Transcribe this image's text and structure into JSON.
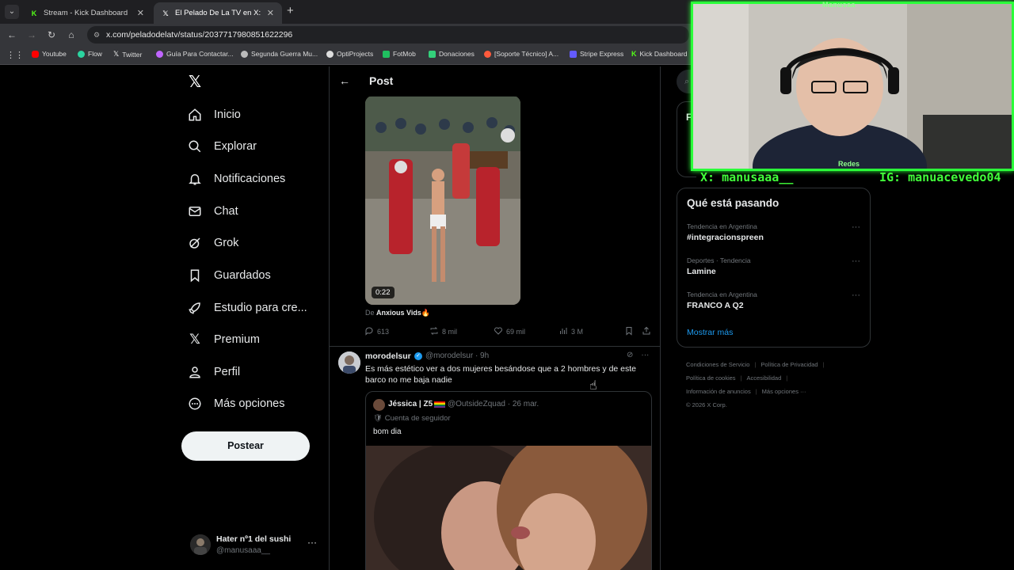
{
  "browser": {
    "tabs": [
      {
        "title": "Stream - Kick Dashboard",
        "icon": "kick-icon",
        "icon_color": "#53fc18"
      },
      {
        "title": "El Pelado De La TV en X: \"Will F",
        "icon": "x-icon",
        "icon_color": "#ffffff"
      }
    ],
    "url": "x.com/peladodelatv/status/2037717980851622296",
    "bookmarks": [
      {
        "label": "Youtube",
        "color": "#ff0000"
      },
      {
        "label": "Flow",
        "color": "#2bd4a0"
      },
      {
        "label": "Twitter",
        "color": "#ffffff"
      },
      {
        "label": "Guía Para Contactar...",
        "color": "#c065ff"
      },
      {
        "label": "Segunda Guerra Mu...",
        "color": "#bbbbbb"
      },
      {
        "label": "OptiProjects",
        "color": "#dddddd"
      },
      {
        "label": "FotMob",
        "color": "#20c060"
      },
      {
        "label": "Donaciones",
        "color": "#33d07a"
      },
      {
        "label": "[Soporte Técnico] A...",
        "color": "#ff5a3c"
      },
      {
        "label": "Stripe Express",
        "color": "#635bff"
      },
      {
        "label": "Kick Dashboard",
        "color": "#53fc18"
      }
    ]
  },
  "nav": {
    "items": [
      {
        "label": "Inicio",
        "icon": "home-icon"
      },
      {
        "label": "Explorar",
        "icon": "search-icon"
      },
      {
        "label": "Notificaciones",
        "icon": "bell-icon"
      },
      {
        "label": "Chat",
        "icon": "mail-icon"
      },
      {
        "label": "Grok",
        "icon": "grok-icon"
      },
      {
        "label": "Guardados",
        "icon": "bookmark-icon"
      },
      {
        "label": "Estudio para cre...",
        "icon": "rocket-icon"
      },
      {
        "label": "Premium",
        "icon": "x-icon"
      },
      {
        "label": "Perfil",
        "icon": "person-icon"
      },
      {
        "label": "Más opciones",
        "icon": "more-circle-icon"
      }
    ],
    "post_button": "Postear",
    "account": {
      "name": "Hater nº1 del sushi",
      "handle": "@manusaaa__"
    }
  },
  "post": {
    "header": "Post",
    "video_duration": "0:22",
    "from_prefix": "De ",
    "from_name": "Anxious Vids🔥",
    "stats": {
      "replies": "613",
      "reposts": "8 mil",
      "likes": "69 mil",
      "views": "3 M"
    }
  },
  "reply": {
    "name": "morodelsur",
    "handle_time": "@morodelsur · 9h",
    "text": "Es más estético ver a dos mujeres besándose que a 2 hombres y de este barco no me baja nadie",
    "quote": {
      "name": "Jéssica | Z5",
      "handle_time": "@OutsideZquad · 26 mar.",
      "badge": "Cuenta de seguidor",
      "text": "bom dia"
    }
  },
  "trends": {
    "title": "Qué está pasando",
    "items": [
      {
        "context": "Tendencia en Argentina",
        "title": "#integracionspreen"
      },
      {
        "context": "Deportes · Tendencia",
        "title": "Lamine"
      },
      {
        "context": "Tendencia en Argentina",
        "title": "FRANCO A Q2"
      }
    ],
    "show_more": "Mostrar más"
  },
  "sidebar_hint": "F",
  "footer": {
    "links": [
      "Condiciones de Servicio",
      "Política de Privacidad",
      "Política de cookies",
      "Accesibilidad",
      "Información de anuncios",
      "Más opciones ···"
    ],
    "copyright": "© 2026 X Corp."
  },
  "overlay": {
    "title": "Manusaa",
    "redes": "Redes",
    "x_handle": "X: manusaaa__",
    "ig_handle": "IG: manuacevedo04"
  }
}
